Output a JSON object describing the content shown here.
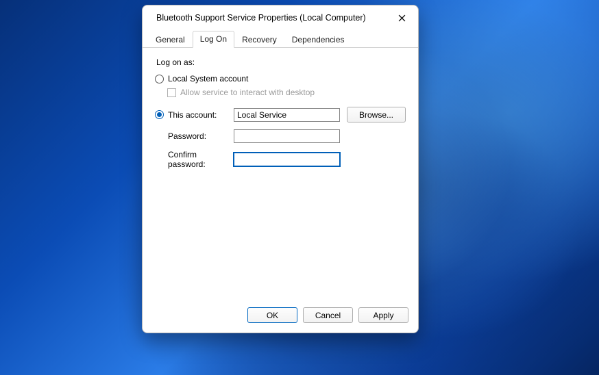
{
  "dialog": {
    "title": "Bluetooth Support Service Properties (Local Computer)"
  },
  "tabs": {
    "general": "General",
    "logon": "Log On",
    "recovery": "Recovery",
    "dependencies": "Dependencies"
  },
  "logon": {
    "section_label": "Log on as:",
    "local_system_label": "Local System account",
    "interact_label": "Allow service to interact with desktop",
    "this_account_label": "This account:",
    "account_value": "Local Service",
    "browse_label": "Browse...",
    "password_label": "Password:",
    "password_value": "",
    "confirm_label": "Confirm password:",
    "confirm_value": "",
    "selected": "this_account"
  },
  "buttons": {
    "ok": "OK",
    "cancel": "Cancel",
    "apply": "Apply"
  }
}
